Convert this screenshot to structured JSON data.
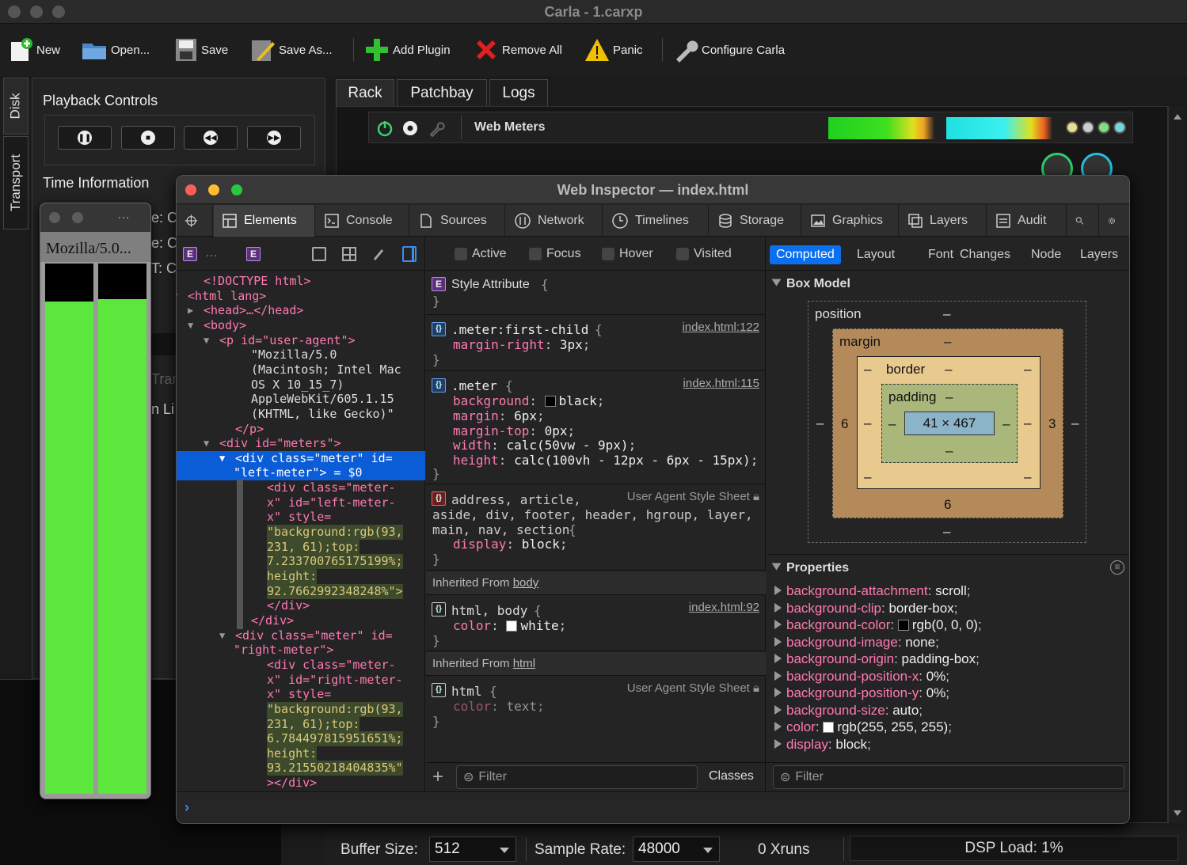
{
  "window": {
    "title": "Carla - 1.carxp"
  },
  "toolbar": {
    "new": "New",
    "open": "Open...",
    "save": "Save",
    "save_as": "Save As...",
    "add_plugin": "Add Plugin",
    "remove_all": "Remove All",
    "panic": "Panic",
    "configure": "Configure Carla"
  },
  "side_tabs": {
    "disk": "Disk",
    "transport": "Transport"
  },
  "panel": {
    "playback_title": "Playback Controls",
    "time_title": "Time Information",
    "time_rows": [
      "e: C",
      "e: C",
      "T: C"
    ],
    "partial": [
      "Tran",
      "n Li"
    ]
  },
  "main_tabs": [
    "Rack",
    "Patchbay",
    "Logs"
  ],
  "rack": {
    "plugin_name": "Web Meters"
  },
  "status": {
    "buffer_label": "Buffer Size:",
    "buffer_value": "512",
    "rate_label": "Sample Rate:",
    "rate_value": "48000",
    "xruns": "0 Xruns",
    "dsp": "DSP Load: 1%"
  },
  "mini_browser": {
    "ua_text": "Mozilla/5.0...",
    "dots": "…",
    "meters": [
      {
        "top_pct": 7.233700765175199
      },
      {
        "top_pct": 6.784497815951651
      }
    ],
    "colors": {
      "meter_fill": "#5ce73d"
    }
  },
  "inspector": {
    "title": "Web Inspector — index.html",
    "tabs": [
      "Elements",
      "Console",
      "Sources",
      "Network",
      "Timelines",
      "Storage",
      "Graphics",
      "Layers",
      "Audit"
    ],
    "breadcrumb_sep": "…",
    "dom_lines": [
      "<!DOCTYPE html>",
      "<html lang>",
      "<head>…</head>",
      "<body>",
      "<p id=\"user-agent\">",
      "\"Mozilla/5.0",
      "(Macintosh; Intel Mac",
      "OS X 10_15_7)",
      "AppleWebKit/605.1.15",
      "(KHTML, like Gecko)\"",
      "</p>",
      "<div id=\"meters\">",
      "<div class=\"meter\" id=",
      "\"left-meter\"> = $0",
      "<div class=\"meter-",
      "x\" id=\"left-meter-",
      "x\" style=",
      "\"background:rgb(93,",
      "231, 61);top:",
      "7.233700765175199%;",
      "height:",
      "92.7662992348248%\">",
      "</div>",
      "</div>",
      "<div class=\"meter\" id=",
      "\"right-meter\">",
      "<div class=\"meter-",
      "x\" id=\"right-meter-",
      "x\" style=",
      "\"background:rgb(93,",
      "231, 61);top:",
      "6.784497815951651%;",
      "height:",
      "93.21550218404835%\"",
      "></div>"
    ],
    "pseudo": [
      "Active",
      "Focus",
      "Hover",
      "Visited"
    ],
    "styles": {
      "style_attr": "Style Attribute",
      "r1_sel": ".meter:first-child",
      "r1_src": "index.html:122",
      "r1_props": [
        [
          "margin-right",
          "3px"
        ]
      ],
      "r2_sel": ".meter",
      "r2_src": "index.html:115",
      "r2_props": [
        [
          "background",
          "black"
        ],
        [
          "margin",
          "6px"
        ],
        [
          "margin-top",
          "0px"
        ],
        [
          "width",
          "calc(50vw - 9px)"
        ],
        [
          "height",
          "calc(100vh - 12px - 6px - 15px)"
        ]
      ],
      "r3_sel1": "address, article,",
      "r3_sel2": "aside, div, footer, header, hgroup, layer,",
      "r3_sel3": "main, nav, section",
      "r3_src": "User Agent Style Sheet",
      "r3_props": [
        [
          "display",
          "block"
        ]
      ],
      "inh_body": "Inherited From",
      "inh_body_link": "body",
      "r4_sel": "html, body",
      "r4_src": "index.html:92",
      "r4_props": [
        [
          "color",
          "white"
        ]
      ],
      "inh_html": "Inherited From",
      "inh_html_link": "html",
      "r5_sel": "html",
      "r5_src": "User Agent Style Sheet",
      "r5_props": [
        [
          "color",
          "text"
        ]
      ],
      "filter": "Filter",
      "classes": "Classes"
    },
    "computed_tabs": [
      "Computed",
      "Layout",
      "Font",
      "Changes",
      "Node",
      "Layers"
    ],
    "box_model": {
      "title": "Box Model",
      "position": "position",
      "margin": "margin",
      "border": "border",
      "padding": "padding",
      "dash": "–",
      "margin_left": "6",
      "margin_right": "3",
      "margin_bottom": "6",
      "content": "41 × 467"
    },
    "properties_title": "Properties",
    "properties": [
      [
        "background-attachment",
        "scroll"
      ],
      [
        "background-clip",
        "border-box"
      ],
      [
        "background-color",
        "rgb(0, 0, 0)"
      ],
      [
        "background-image",
        "none"
      ],
      [
        "background-origin",
        "padding-box"
      ],
      [
        "background-position-x",
        "0%"
      ],
      [
        "background-position-y",
        "0%"
      ],
      [
        "background-size",
        "auto"
      ],
      [
        "color",
        "rgb(255, 255, 255)"
      ],
      [
        "display",
        "block"
      ]
    ],
    "computed_filter": "Filter"
  }
}
